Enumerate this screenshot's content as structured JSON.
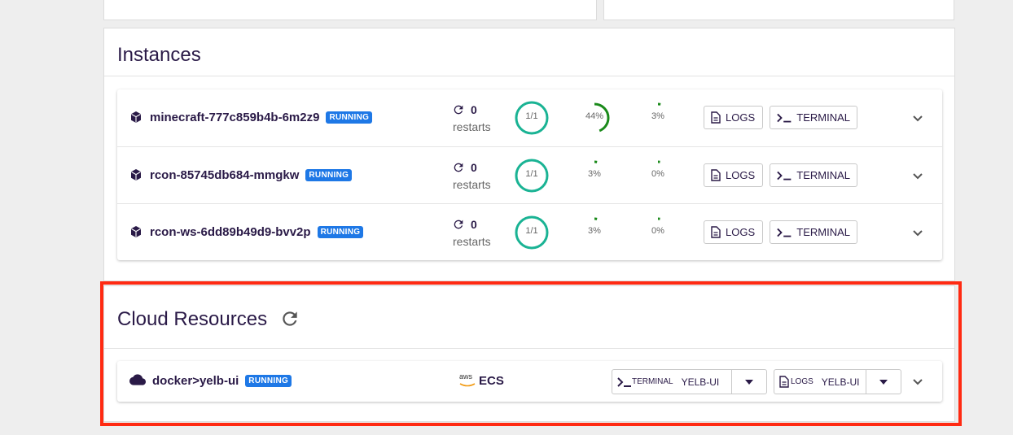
{
  "instances": {
    "title": "Instances",
    "rows": [
      {
        "name": "minecraft-777c859b4b-6m2z9",
        "status": "RUNNING",
        "restarts": "0",
        "restarts_label": "restarts",
        "ready": "1/1",
        "cpu": "44%",
        "cpu_fill": 0.44,
        "mem": "3%",
        "mem_fill": 0.03
      },
      {
        "name": "rcon-85745db684-mmgkw",
        "status": "RUNNING",
        "restarts": "0",
        "restarts_label": "restarts",
        "ready": "1/1",
        "cpu": "3%",
        "cpu_fill": 0.03,
        "mem": "0%",
        "mem_fill": 0.0
      },
      {
        "name": "rcon-ws-6dd89b49d9-bvv2p",
        "status": "RUNNING",
        "restarts": "0",
        "restarts_label": "restarts",
        "ready": "1/1",
        "cpu": "3%",
        "cpu_fill": 0.03,
        "mem": "0%",
        "mem_fill": 0.0
      }
    ],
    "logs_label": "LOGS",
    "terminal_label": "TERMINAL"
  },
  "cloud": {
    "title": "Cloud Resources",
    "resource": {
      "name": "docker>yelb-ui",
      "status": "RUNNING",
      "provider_logo": "aws",
      "service": "ECS",
      "terminal_label": "TERMINAL",
      "terminal_target": "YELB-UI",
      "logs_label": "LOGS",
      "logs_target": "YELB-UI"
    }
  },
  "colors": {
    "accent": "#1e78e6",
    "ring": "#1ab394",
    "gauge": "#1a8a1a",
    "highlight": "#ff2a12",
    "text": "#2a1a47"
  },
  "icons": [
    "cube-icon",
    "restart-icon",
    "document-icon",
    "terminal-icon",
    "chevron-down-icon",
    "cloud-icon",
    "refresh-icon",
    "caret-down-icon"
  ]
}
